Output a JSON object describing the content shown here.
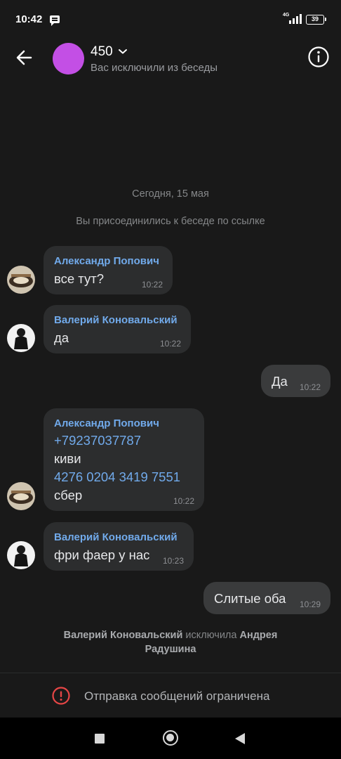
{
  "status_bar": {
    "time": "10:42",
    "network": "4G",
    "battery": "39",
    "icons": [
      "message-icon",
      "signal-icon",
      "battery-icon"
    ]
  },
  "header": {
    "title": "450",
    "subtitle": "Вас исключили из беседы",
    "icons": [
      "back-arrow-icon",
      "chevron-down-icon",
      "info-icon"
    ],
    "avatar_color": "#c34fe5"
  },
  "date_separator": "Сегодня, 15 мая",
  "service_join": "Вы присоединились к беседе по ссылке",
  "messages": [
    {
      "author": "Александр Попович",
      "text": "все тут?",
      "time": "10:22"
    },
    {
      "author": "Валерий Коновальский",
      "text": "да",
      "time": "10:22"
    },
    {
      "text": "Да",
      "time": "10:22",
      "outgoing": true
    },
    {
      "author": "Александр Попович",
      "lines": [
        "+79237037787",
        "киви",
        "4276 0204 3419 7551",
        "сбер"
      ],
      "time": "10:22"
    },
    {
      "author": "Валерий Коновальский",
      "text": "фри фаер у нас",
      "time": "10:23"
    },
    {
      "text": "Слитые оба",
      "time": "10:29",
      "outgoing": true
    }
  ],
  "service_kick": {
    "actor": "Валерий Коновальский",
    "verb": "исключила",
    "target": "Андрея Радушина"
  },
  "footer": {
    "restriction_text": "Отправка сообщений ограничена",
    "icon": "warning-circle-icon"
  },
  "colors": {
    "background": "#191919",
    "bubble_in": "#2c2d2e",
    "bubble_out": "#3a3b3c",
    "accent": "#71aaeb",
    "warning": "#e64646"
  }
}
